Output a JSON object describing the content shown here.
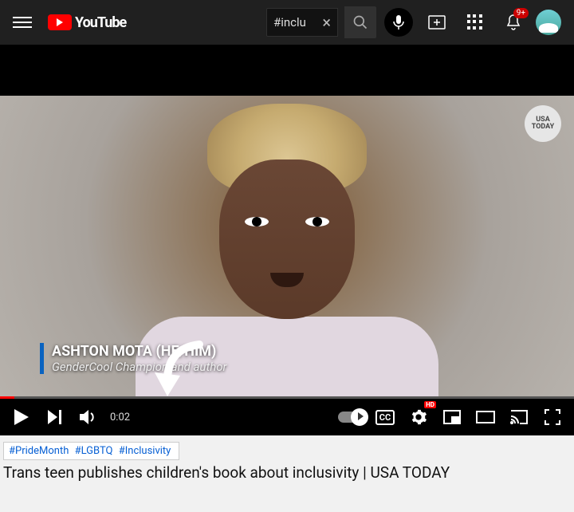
{
  "header": {
    "logo_text": "YouTube",
    "search_value": "#inclu",
    "notification_count": "9+"
  },
  "video": {
    "chyron_name": "ASHTON MOTA (HE/HIM)",
    "chyron_subtitle": "GenderCool Champion and author",
    "watermark_line1": "USA",
    "watermark_line2": "TODAY",
    "current_time": "0:02",
    "cc_label": "CC",
    "hd_label": "HD"
  },
  "below": {
    "hashtags": [
      "#PrideMonth",
      "#LGBTQ",
      "#Inclusivity"
    ],
    "title": "Trans teen publishes children's book about inclusivity | USA TODAY"
  }
}
